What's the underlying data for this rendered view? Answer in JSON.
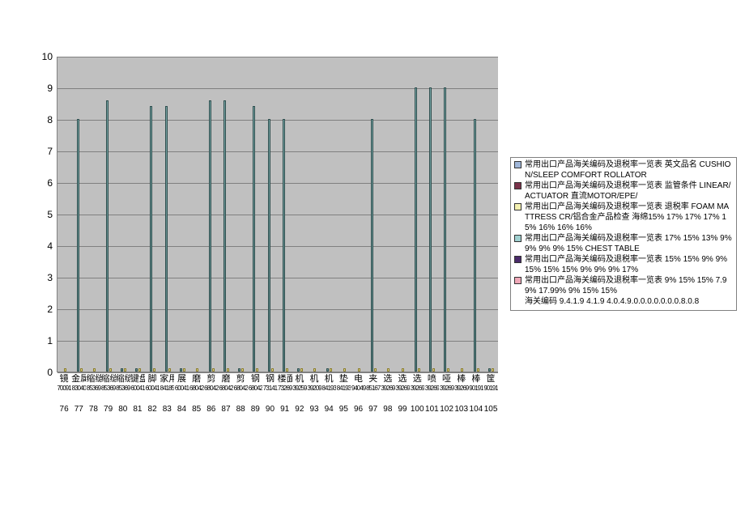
{
  "chart_data": {
    "type": "bar",
    "title": "",
    "xlabel": "",
    "ylabel": "",
    "ylim": [
      0,
      10
    ],
    "yticks": [
      0,
      1,
      2,
      3,
      4,
      5,
      6,
      7,
      8,
      9,
      10
    ],
    "categories_index": [
      76,
      77,
      78,
      79,
      80,
      81,
      82,
      83,
      84,
      85,
      86,
      87,
      88,
      89,
      90,
      91,
      92,
      93,
      94,
      95,
      96,
      97,
      98,
      99,
      100,
      101,
      102,
      103,
      104,
      105
    ],
    "categories_cn": [
      "镜",
      "金属",
      "缩缝",
      "缩缝",
      "缩缝",
      "键盘",
      "脚",
      "家用",
      "展",
      "磨",
      "剪",
      "磨",
      "剪",
      "钢",
      "钢",
      "楼面",
      "机",
      "机",
      "机",
      "垫",
      "电",
      "夹",
      "选",
      "选",
      "选",
      "喷",
      "哑",
      "棒",
      "棒",
      "筐"
    ],
    "categories_code": [
      "70091",
      "83040",
      "85369",
      "85369",
      "85369",
      "60041",
      "60041",
      "84185",
      "60041",
      "68042",
      "68042",
      "68042",
      "68042",
      "68042",
      "73141",
      "73269",
      "39259",
      "39209",
      "84193",
      "84193",
      "94049",
      "85167",
      "39269",
      "39269",
      "39269",
      "39269",
      "39269",
      "39269",
      "90191",
      "90191"
    ],
    "tall_values": [
      0,
      8.0,
      0,
      8.6,
      0.1,
      0.1,
      8.4,
      8.4,
      0.1,
      0,
      8.6,
      8.6,
      0.1,
      8.4,
      8.0,
      8.0,
      0.1,
      0,
      0.1,
      0,
      0,
      8.0,
      0,
      0,
      9.0,
      9.0,
      9.0,
      0,
      8.0,
      0.1
    ],
    "short_values": [
      0.1,
      0.1,
      0.1,
      0.1,
      0.1,
      0.1,
      0.1,
      0.1,
      0.1,
      0.1,
      0.1,
      0.1,
      0.1,
      0.1,
      0.1,
      0.1,
      0.1,
      0.1,
      0.1,
      0.1,
      0.1,
      0.1,
      0.1,
      0.1,
      0.1,
      0.1,
      0.1,
      0.1,
      0.1,
      0.1
    ]
  },
  "legend": {
    "items": [
      {
        "swatch": "sw-blue",
        "text": "常用出口产品海关编码及退税率一览表 英文品名 CUSHION/SLEEP COMFORT ROLLATOR"
      },
      {
        "swatch": "sw-maroon",
        "text": "常用出口产品海关编码及退税率一览表 监管条件 LINEAR/ACTUATOR 直流MOTOR/EPE/"
      },
      {
        "swatch": "sw-yellow",
        "text": "常用出口产品海关编码及退税率一览表 退税率 FOAM MATTRESS CR/铝合金产品检查 海绵15% 17% 17% 17% 15% 16% 16% 16%"
      },
      {
        "swatch": "sw-teal",
        "text": "常用出口产品海关编码及退税率一览表 17% 15% 13% 9% 9% 9% 9% 15% CHEST TABLE"
      },
      {
        "swatch": "sw-purple",
        "text": "常用出口产品海关编码及退税率一览表 15% 15% 9% 9% 15% 15% 15% 9% 9% 9% 17%"
      },
      {
        "swatch": "sw-pink",
        "text": "常用出口产品海关编码及退税率一览表 9% 15% 15% 7.99% 17.99% 9% 15% 15%"
      }
    ],
    "extra_text": "海关编码 9.4.1.9 4.1.9 4.0.4.9.0.0.0.0.0.0.0.8.0.8"
  }
}
